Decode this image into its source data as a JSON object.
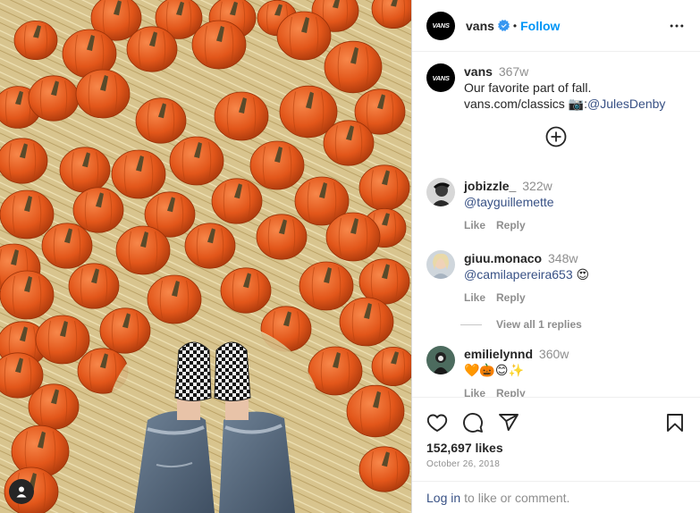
{
  "header": {
    "username": "vans",
    "follow_label": "Follow",
    "separator": "•",
    "avatar_text": "VANS"
  },
  "caption": {
    "username": "vans",
    "time": "367w",
    "line1": "Our favorite part of fall.",
    "line2_prefix": "vans.com/classics ",
    "camera_emoji": "📷",
    "line2_colon": ":",
    "mention": "@JulesDenby"
  },
  "comments": [
    {
      "username": "jobizzle_",
      "time": "322w",
      "text_mention": "@tayguillemette",
      "text_suffix": "",
      "like_label": "Like",
      "reply_label": "Reply"
    },
    {
      "username": "giuu.monaco",
      "time": "348w",
      "text_mention": "@camilapereira653",
      "text_suffix": " 😍",
      "like_label": "Like",
      "reply_label": "Reply"
    },
    {
      "username": "emilielynnd",
      "time": "360w",
      "text_mention": "",
      "text_suffix": "🧡🎃😊✨",
      "like_label": "Like",
      "reply_label": "Reply"
    }
  ],
  "view_replies_label": "View all 1 replies",
  "stats": {
    "likes": "152,697 likes",
    "date": "October 26, 2018"
  },
  "login": {
    "link_label": "Log in",
    "suffix": "to like or comment."
  },
  "colors": {
    "accent_blue": "#0095f6",
    "link_blue": "#385185",
    "verified_blue": "#3897f0",
    "secondary_text": "#8e8e8e"
  },
  "icons": {
    "verified": "verified-badge-icon",
    "more": "more-options-icon",
    "add": "add-circle-icon",
    "like": "heart-icon",
    "comment": "comment-icon",
    "share": "paper-plane-icon",
    "save": "bookmark-icon",
    "user_tag": "user-tag-icon"
  }
}
